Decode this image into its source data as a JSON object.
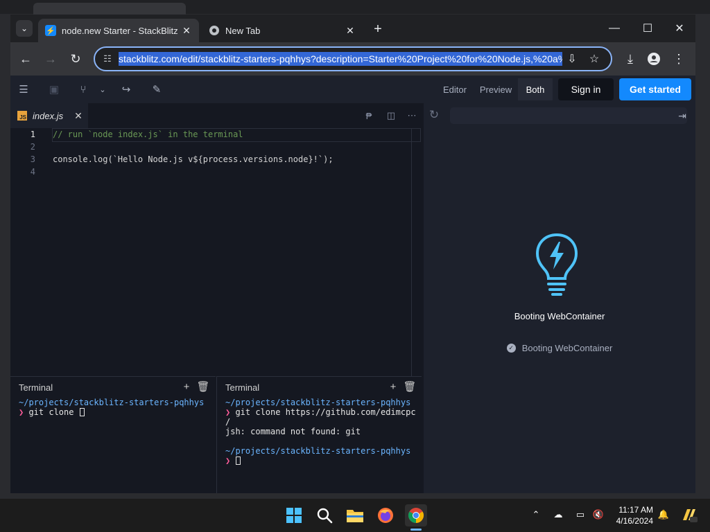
{
  "browser": {
    "tabs": [
      {
        "title": "node.new Starter - StackBlitz",
        "active": true
      },
      {
        "title": "New Tab",
        "active": false
      }
    ],
    "url": "stackblitz.com/edit/stackblitz-starters-pqhhys?description=Starter%20Project%20for%20Node.js,%20a%"
  },
  "stackblitz": {
    "view_modes": [
      "Editor",
      "Preview",
      "Both"
    ],
    "selected_view": "Both",
    "sign_in": "Sign in",
    "get_started": "Get started",
    "accent_color": "#1389fd"
  },
  "editor": {
    "filename": "index.js",
    "file_badge": "JS",
    "lines": [
      {
        "num": "1",
        "text": "// run `node index.js` in the terminal"
      },
      {
        "num": "2",
        "text": ""
      },
      {
        "num": "3",
        "text": "console.log(`Hello Node.js v${process.versions.node}!`);"
      },
      {
        "num": "4",
        "text": ""
      }
    ]
  },
  "preview": {
    "title": "Booting WebContainer",
    "status": "Booting WebContainer"
  },
  "terminals": [
    {
      "title": "Terminal",
      "path": "~/projects/stackblitz-starters-pqhhys",
      "command": "git clone "
    },
    {
      "title": "Terminal",
      "path": "~/projects/stackblitz-starters-pqhhys",
      "command": "git clone https://github.com/edimcpc",
      "wrap": "/",
      "error": "jsh: command not found: git",
      "path2": "~/projects/stackblitz-starters-pqhhys"
    }
  ],
  "taskbar": {
    "time": "11:17 AM",
    "date": "4/16/2024"
  }
}
